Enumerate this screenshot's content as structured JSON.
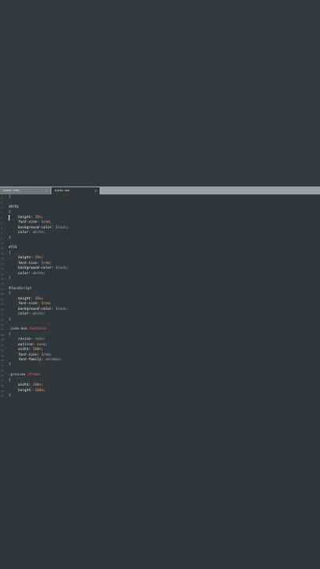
{
  "tabs": [
    {
      "label": "index.html",
      "active": false
    },
    {
      "label": "style.css",
      "active": true
    }
  ],
  "close_glyph": "×",
  "code_lines": [
    {
      "n": "1",
      "parts": [
        {
          "t": "}",
          "c": "brace"
        }
      ]
    },
    {
      "n": "2",
      "parts": []
    },
    {
      "n": "3",
      "parts": [
        {
          "t": "#HTML",
          "c": "sel"
        }
      ]
    },
    {
      "n": "4",
      "parts": [
        {
          "t": "{",
          "c": "brace"
        }
      ]
    },
    {
      "n": "5",
      "indent": true,
      "parts": [
        {
          "t": "height",
          "c": "prop"
        },
        {
          "t": ": ",
          "c": "punct"
        },
        {
          "t": "35%",
          "c": "val-num"
        },
        {
          "t": ";",
          "c": "punct"
        }
      ]
    },
    {
      "n": "6",
      "indent": true,
      "parts": [
        {
          "t": "font-size",
          "c": "prop"
        },
        {
          "t": ": ",
          "c": "punct"
        },
        {
          "t": "1rem",
          "c": "val-num"
        },
        {
          "t": ";",
          "c": "punct"
        }
      ]
    },
    {
      "n": "7",
      "indent": true,
      "parts": [
        {
          "t": "background-color",
          "c": "prop"
        },
        {
          "t": ": ",
          "c": "punct"
        },
        {
          "t": "black",
          "c": "val-kw"
        },
        {
          "t": ";",
          "c": "punct"
        }
      ]
    },
    {
      "n": "8",
      "indent": true,
      "parts": [
        {
          "t": "color",
          "c": "prop"
        },
        {
          "t": ": ",
          "c": "punct"
        },
        {
          "t": "white",
          "c": "val-kw"
        },
        {
          "t": ";",
          "c": "punct"
        }
      ]
    },
    {
      "n": "9",
      "parts": [
        {
          "t": "}",
          "c": "brace"
        }
      ]
    },
    {
      "n": "10",
      "parts": []
    },
    {
      "n": "11",
      "parts": [
        {
          "t": "#CSS",
          "c": "sel"
        }
      ]
    },
    {
      "n": "12",
      "parts": [
        {
          "t": "{",
          "c": "brace"
        }
      ]
    },
    {
      "n": "13",
      "indent": true,
      "parts": [
        {
          "t": "height",
          "c": "prop"
        },
        {
          "t": ": ",
          "c": "punct"
        },
        {
          "t": "35%",
          "c": "val-num"
        },
        {
          "t": ";",
          "c": "punct"
        }
      ]
    },
    {
      "n": "14",
      "indent": true,
      "parts": [
        {
          "t": "font-size",
          "c": "prop"
        },
        {
          "t": ": ",
          "c": "punct"
        },
        {
          "t": "1rem",
          "c": "val-num"
        },
        {
          "t": ";",
          "c": "punct"
        }
      ]
    },
    {
      "n": "15",
      "indent": true,
      "parts": [
        {
          "t": "background-color",
          "c": "prop"
        },
        {
          "t": ": ",
          "c": "punct"
        },
        {
          "t": "black",
          "c": "val-kw"
        },
        {
          "t": ";",
          "c": "punct"
        }
      ]
    },
    {
      "n": "16",
      "indent": true,
      "parts": [
        {
          "t": "color",
          "c": "prop"
        },
        {
          "t": ": ",
          "c": "punct"
        },
        {
          "t": "white",
          "c": "val-kw"
        },
        {
          "t": ";",
          "c": "punct"
        }
      ]
    },
    {
      "n": "17",
      "parts": [
        {
          "t": "}",
          "c": "brace"
        }
      ]
    },
    {
      "n": "18",
      "parts": []
    },
    {
      "n": "19",
      "parts": [
        {
          "t": "#JavaScript",
          "c": "sel"
        }
      ]
    },
    {
      "n": "20",
      "parts": [
        {
          "t": "{",
          "c": "brace"
        }
      ]
    },
    {
      "n": "21",
      "indent": true,
      "parts": [
        {
          "t": "height",
          "c": "prop"
        },
        {
          "t": ": ",
          "c": "punct"
        },
        {
          "t": "35%",
          "c": "val-num"
        },
        {
          "t": ";",
          "c": "punct"
        }
      ]
    },
    {
      "n": "22",
      "indent": true,
      "parts": [
        {
          "t": "font-size",
          "c": "prop"
        },
        {
          "t": ": ",
          "c": "punct"
        },
        {
          "t": "1rem",
          "c": "val-num"
        },
        {
          "t": ";",
          "c": "punct"
        }
      ]
    },
    {
      "n": "23",
      "indent": true,
      "parts": [
        {
          "t": "background-color",
          "c": "prop"
        },
        {
          "t": ": ",
          "c": "punct"
        },
        {
          "t": "black",
          "c": "val-kw"
        },
        {
          "t": ";",
          "c": "punct"
        }
      ]
    },
    {
      "n": "24",
      "indent": true,
      "parts": [
        {
          "t": "color",
          "c": "prop"
        },
        {
          "t": ": ",
          "c": "punct"
        },
        {
          "t": "white",
          "c": "val-kw"
        },
        {
          "t": ";",
          "c": "punct"
        }
      ]
    },
    {
      "n": "25",
      "parts": [
        {
          "t": "}",
          "c": "brace"
        }
      ]
    },
    {
      "n": "26",
      "parts": []
    },
    {
      "n": "27",
      "parts": [
        {
          "t": ".code-box ",
          "c": "sel"
        },
        {
          "t": "textarea",
          "c": "sel-accent"
        }
      ]
    },
    {
      "n": "28",
      "parts": [
        {
          "t": "{",
          "c": "brace"
        }
      ]
    },
    {
      "n": "29",
      "indent": true,
      "parts": [
        {
          "t": "resize",
          "c": "prop"
        },
        {
          "t": ": ",
          "c": "punct"
        },
        {
          "t": "none",
          "c": "val-kw"
        },
        {
          "t": ";",
          "c": "punct"
        }
      ]
    },
    {
      "n": "30",
      "indent": true,
      "parts": [
        {
          "t": "outline",
          "c": "prop"
        },
        {
          "t": ": ",
          "c": "punct"
        },
        {
          "t": "none",
          "c": "val-kw"
        },
        {
          "t": ";",
          "c": "punct"
        }
      ]
    },
    {
      "n": "31",
      "indent": true,
      "parts": [
        {
          "t": "width",
          "c": "prop-up"
        },
        {
          "t": ": ",
          "c": "punct"
        },
        {
          "t": "100%",
          "c": "val-num"
        },
        {
          "t": ";",
          "c": "punct"
        }
      ]
    },
    {
      "n": "32",
      "indent": true,
      "parts": [
        {
          "t": "font-size",
          "c": "prop"
        },
        {
          "t": ": ",
          "c": "punct"
        },
        {
          "t": "1rem",
          "c": "val-num"
        },
        {
          "t": ";",
          "c": "punct"
        }
      ]
    },
    {
      "n": "33",
      "indent": true,
      "parts": [
        {
          "t": "font-family",
          "c": "prop"
        },
        {
          "t": ": ",
          "c": "punct"
        },
        {
          "t": "verdana",
          "c": "val-kw"
        },
        {
          "t": ";",
          "c": "punct"
        }
      ]
    },
    {
      "n": "34",
      "parts": [
        {
          "t": "}",
          "c": "brace"
        }
      ]
    },
    {
      "n": "35",
      "parts": []
    },
    {
      "n": "36",
      "parts": [
        {
          "t": ".preview ",
          "c": "sel"
        },
        {
          "t": "iframe",
          "c": "sel-accent"
        }
      ]
    },
    {
      "n": "37",
      "parts": [
        {
          "t": "{",
          "c": "brace"
        }
      ]
    },
    {
      "n": "38",
      "indent": true,
      "parts": [
        {
          "t": "width",
          "c": "prop-up"
        },
        {
          "t": ": ",
          "c": "punct"
        },
        {
          "t": "100%",
          "c": "val-num"
        },
        {
          "t": ";",
          "c": "punct"
        }
      ]
    },
    {
      "n": "39",
      "indent": true,
      "parts": [
        {
          "t": "height",
          "c": "prop-up"
        },
        {
          "t": ": ",
          "c": "punct"
        },
        {
          "t": "100%",
          "c": "val-num"
        },
        {
          "t": ";",
          "c": "punct"
        }
      ]
    },
    {
      "n": "40",
      "parts": [
        {
          "t": "}",
          "c": "brace"
        }
      ]
    }
  ]
}
